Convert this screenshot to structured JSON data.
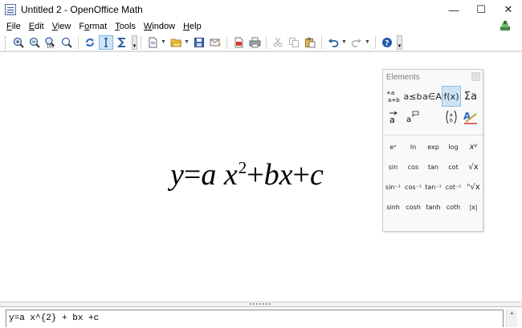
{
  "window": {
    "title": "Untitled 2 - OpenOffice Math",
    "minimize_glyph": "—",
    "maximize_glyph": "☐",
    "close_glyph": "✕"
  },
  "menu": {
    "items": [
      {
        "underline": "F",
        "rest": "ile"
      },
      {
        "underline": "E",
        "rest": "dit"
      },
      {
        "underline": "V",
        "rest": "iew"
      },
      {
        "pre": "F",
        "underline": "o",
        "rest": "rmat"
      },
      {
        "underline": "T",
        "rest": "ools"
      },
      {
        "underline": "W",
        "rest": "indow"
      },
      {
        "underline": "H",
        "rest": "elp"
      }
    ]
  },
  "toolbar": {
    "icons": [
      "zoom-in-icon",
      "zoom-out-icon",
      "zoom-100-icon",
      "show-all-icon",
      "update-icon",
      "formula-cursor-icon",
      "symbols-icon",
      "new-icon",
      "open-icon",
      "save-icon",
      "email-icon",
      "export-pdf-icon",
      "print-icon",
      "cut-icon",
      "copy-icon",
      "paste-icon",
      "undo-icon",
      "redo-icon",
      "help-icon"
    ],
    "zoom_100_label": "100"
  },
  "formula": {
    "y": "y",
    "eq": "=",
    "a": "a",
    "x": "x",
    "exp": "2",
    "plus1": "+",
    "bx": "bx",
    "plus2": "+",
    "c": "c"
  },
  "elements_panel": {
    "title": "Elements",
    "categories": [
      {
        "label": "+a a+b",
        "name": "unary-binary-category"
      },
      {
        "label": "a≤b",
        "name": "relations-category"
      },
      {
        "label": "a∈A",
        "name": "set-operations-category"
      },
      {
        "label": "f(x)",
        "name": "functions-category"
      },
      {
        "label": "Σa",
        "name": "operators-category"
      },
      {
        "label": "a⃗",
        "name": "attributes-category"
      },
      {
        "label": "a⁹",
        "name": "others-category"
      },
      {
        "label": "",
        "name": "empty-category"
      },
      {
        "label": "(ᵃᵦ)",
        "name": "brackets-category"
      },
      {
        "label": "",
        "name": "formats-category"
      }
    ],
    "functions": [
      {
        "label": "eˣ",
        "name": "exp-power-element"
      },
      {
        "label": "ln",
        "name": "ln-element"
      },
      {
        "label": "exp",
        "name": "exp-element"
      },
      {
        "label": "log",
        "name": "log-element"
      },
      {
        "label": "xʸ",
        "name": "power-element"
      },
      {
        "label": "sin",
        "name": "sin-element"
      },
      {
        "label": "cos",
        "name": "cos-element"
      },
      {
        "label": "tan",
        "name": "tan-element"
      },
      {
        "label": "cot",
        "name": "cot-element"
      },
      {
        "label": "√x",
        "name": "sqrt-element"
      },
      {
        "label": "sin⁻¹",
        "name": "arcsin-element"
      },
      {
        "label": "cos⁻¹",
        "name": "arccos-element"
      },
      {
        "label": "tan⁻¹",
        "name": "arctan-element"
      },
      {
        "label": "cot⁻¹",
        "name": "arccot-element"
      },
      {
        "label": "ⁿ√x",
        "name": "nroot-element"
      },
      {
        "label": "sinh",
        "name": "sinh-element"
      },
      {
        "label": "cosh",
        "name": "cosh-element"
      },
      {
        "label": "tanh",
        "name": "tanh-element"
      },
      {
        "label": "coth",
        "name": "coth-element"
      },
      {
        "label": "|x|",
        "name": "abs-element"
      }
    ]
  },
  "command": {
    "text": "y=a x^{2} + bx +c"
  },
  "colors": {
    "accent": "#cde4f7",
    "accent_border": "#7eb4ea"
  }
}
